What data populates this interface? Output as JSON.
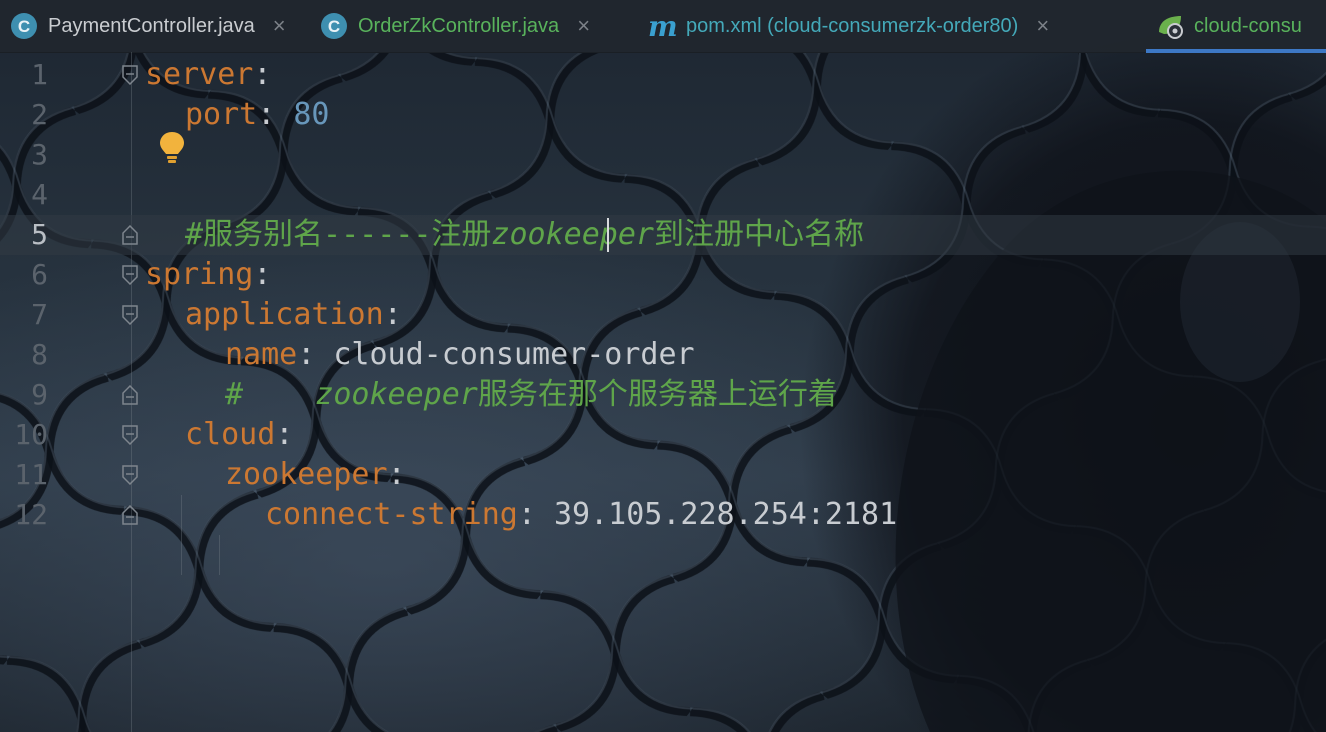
{
  "tabs": [
    {
      "label": "PaymentController.java",
      "icon": "java-class-icon",
      "close": "×"
    },
    {
      "label": "OrderZkController.java",
      "icon": "java-class-icon",
      "close": "×"
    },
    {
      "label": "pom.xml (cloud-consumerzk-order80)",
      "icon": "maven-icon",
      "icon_glyph": "m",
      "close": "×"
    },
    {
      "label": "cloud-consu",
      "icon": "spring-config-icon"
    }
  ],
  "editor": {
    "line_numbers": [
      "1",
      "2",
      "3",
      "4",
      "5",
      "6",
      "7",
      "8",
      "9",
      "10",
      "11",
      "12"
    ],
    "current_line": "5",
    "lines": {
      "l1": {
        "key": "server",
        "punc": ":"
      },
      "l2": {
        "key": "port",
        "punc": ": ",
        "value": "80"
      },
      "l5": {
        "comment_a": "#服务别名------注册",
        "comment_b": "zookeeper",
        "comment_c": "到注册中心名称"
      },
      "l6": {
        "key": "spring",
        "punc": ":"
      },
      "l7": {
        "key": "application",
        "punc": ":"
      },
      "l8": {
        "key": "name",
        "punc": ": ",
        "value": "cloud-consumer-order"
      },
      "l9": {
        "comment_a": "#    ",
        "comment_b": "zookeeper",
        "comment_c": "服务在那个服务器上运行着"
      },
      "l10": {
        "key": "cloud",
        "punc": ":"
      },
      "l11": {
        "key": "zookeeper",
        "punc": ":"
      },
      "l12": {
        "key": "connect-string",
        "punc": ": ",
        "value": "39.105.228.254:2181"
      }
    }
  },
  "colors": {
    "key": "#cc7832",
    "number": "#6897bb",
    "comment": "#5fa54a",
    "active_tab_underline": "#3d78c5"
  }
}
